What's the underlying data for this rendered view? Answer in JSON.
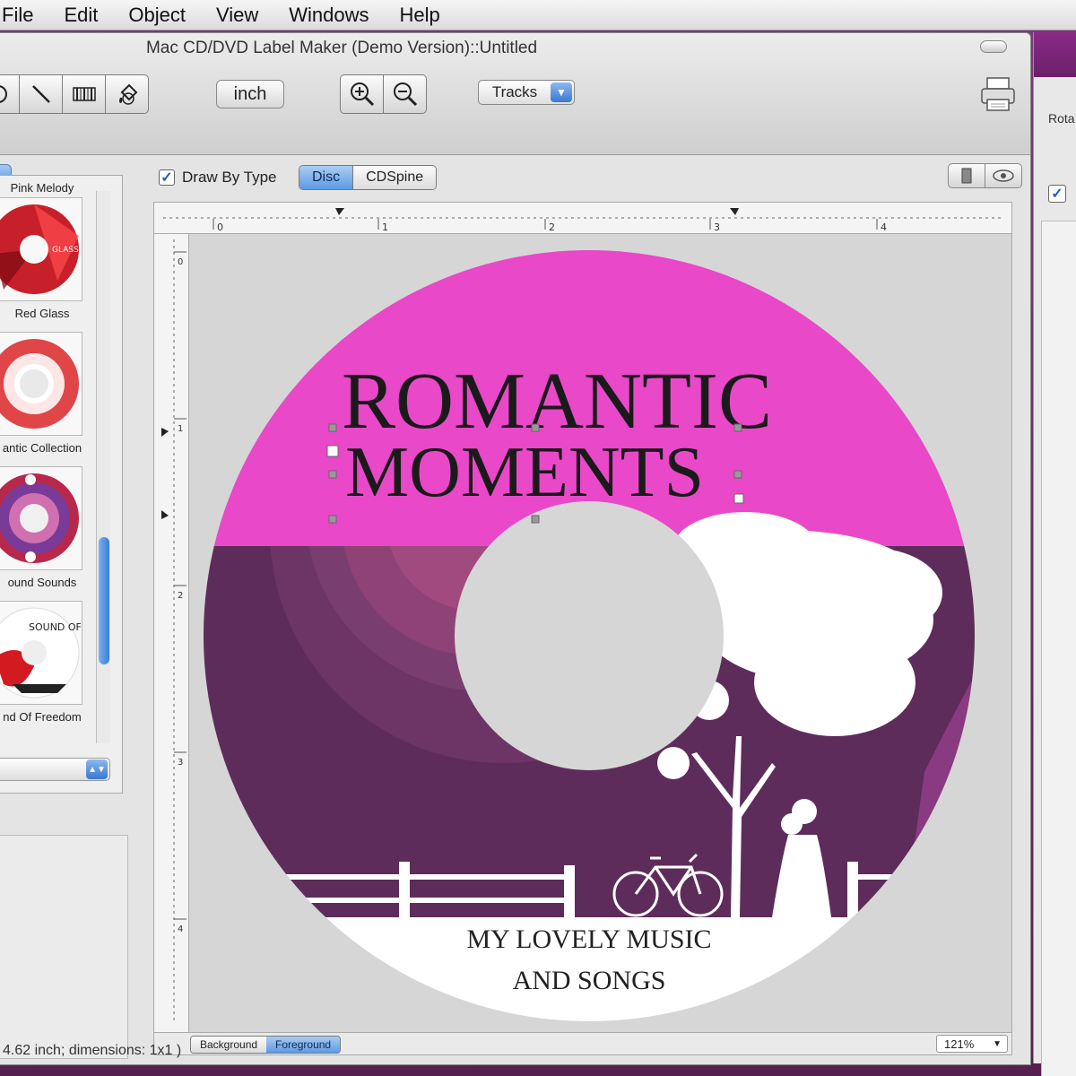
{
  "menubar": {
    "items": [
      "File",
      "Edit",
      "Object",
      "View",
      "Windows",
      "Help"
    ]
  },
  "window": {
    "title": "Mac CD/DVD Label Maker (Demo Version)::Untitled"
  },
  "toolbar": {
    "unit_label": "inch",
    "tracks_label": "Tracks"
  },
  "subbar": {
    "draw_by_type_label": "Draw By Type",
    "draw_by_type_checked": true,
    "segments": [
      "Disc",
      "CDSpine"
    ],
    "active_segment": "Disc"
  },
  "ruler": {
    "h_ticks": [
      "0",
      "1",
      "2",
      "3",
      "4"
    ],
    "v_ticks": [
      "0",
      "1",
      "2",
      "3",
      "4"
    ]
  },
  "templates": [
    {
      "name": "Pink Melody"
    },
    {
      "name": "Red Glass"
    },
    {
      "name": "antic Collection"
    },
    {
      "name": "ound Sounds"
    },
    {
      "name": "nd Of Freedom"
    }
  ],
  "thumb_texts": {
    "red_glass": "GLASS",
    "sound_of": "SOUND OF"
  },
  "label": {
    "title_line1": "ROMANTIC",
    "title_line2": "MOMENTS",
    "bottom_line1": "MY LOVELY MUSIC",
    "bottom_line2": "AND SONGS",
    "colors": {
      "top_band": "#e948c8",
      "middle": "#5e2c5a",
      "bottom": "#ffffff"
    }
  },
  "layers": {
    "items": [
      "Background",
      "Foreground"
    ],
    "active": "Foreground"
  },
  "zoom": {
    "value": "121%"
  },
  "status": {
    "text": "4.62 inch; dimensions: 1x1 )"
  },
  "right_panel": {
    "label": "Rota"
  }
}
